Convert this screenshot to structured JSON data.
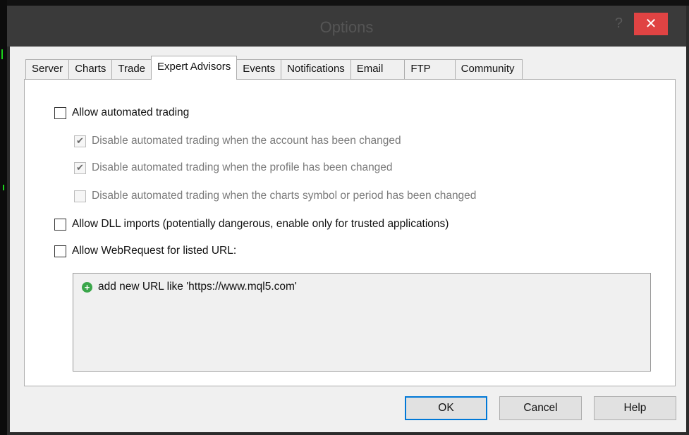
{
  "window": {
    "title": "Options",
    "help_glyph": "?",
    "close_glyph": "✕"
  },
  "tabs": [
    {
      "label": "Server"
    },
    {
      "label": "Charts"
    },
    {
      "label": "Trade"
    },
    {
      "label": "Expert Advisors",
      "active": true
    },
    {
      "label": "Events"
    },
    {
      "label": "Notifications"
    },
    {
      "label": "Email"
    },
    {
      "label": "FTP"
    },
    {
      "label": "Community"
    }
  ],
  "options": {
    "allow_automated_trading": {
      "label": "Allow automated trading",
      "checked": false
    },
    "disable_on_account_change": {
      "label": "Disable automated trading when the account has been changed",
      "checked": true,
      "enabled": false
    },
    "disable_on_profile_change": {
      "label": "Disable automated trading when the profile has been changed",
      "checked": true,
      "enabled": false
    },
    "disable_on_symbol_change": {
      "label": "Disable automated trading when the charts symbol or period has been changed",
      "checked": false,
      "enabled": false
    },
    "allow_dll_imports": {
      "label": "Allow DLL imports (potentially dangerous, enable only for trusted applications)",
      "checked": false
    },
    "allow_webrequest": {
      "label": "Allow WebRequest for listed URL:",
      "checked": false
    }
  },
  "url_list": {
    "add_item": "add new URL like 'https://www.mql5.com'"
  },
  "buttons": {
    "ok": "OK",
    "cancel": "Cancel",
    "help": "Help"
  },
  "colors": {
    "close_button": "#e04343",
    "add_icon": "#3aa64a",
    "default_button_border": "#0078d7"
  }
}
